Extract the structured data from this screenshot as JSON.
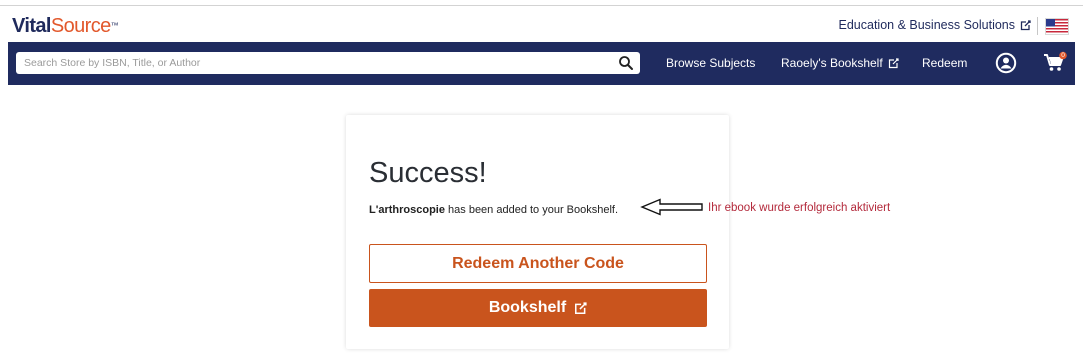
{
  "header": {
    "logo_vital": "Vital",
    "logo_source": "Source",
    "edu_link": "Education & Business Solutions"
  },
  "nav": {
    "search_placeholder": "Search Store by ISBN, Title, or Author",
    "browse_subjects": "Browse Subjects",
    "bookshelf": "Raoely's Bookshelf",
    "redeem": "Redeem",
    "cart_count": "0"
  },
  "card": {
    "title": "Success!",
    "book_title": "L'arthroscopie",
    "message_suffix": "has been added to your Bookshelf.",
    "redeem_another": "Redeem Another Code",
    "bookshelf_button": "Bookshelf"
  },
  "annotation": {
    "text": "Ihr ebook wurde erfolgreich aktiviert"
  },
  "colors": {
    "nav_bg": "#1f2b5f",
    "accent": "#c9541d",
    "annotation": "#b3293b"
  }
}
